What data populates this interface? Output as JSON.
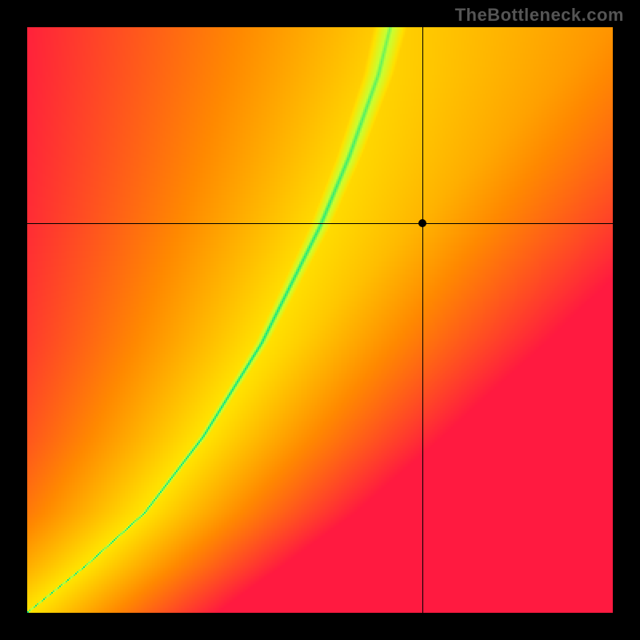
{
  "watermark": "TheBottleneck.com",
  "chart_data": {
    "type": "heatmap",
    "title": "",
    "xlabel": "",
    "ylabel": "",
    "xlim": [
      0,
      1
    ],
    "ylim": [
      0,
      1
    ],
    "marker": {
      "x": 0.675,
      "y": 0.665
    },
    "crosshair": {
      "x": 0.675,
      "y": 0.665
    },
    "ideal_curve": {
      "description": "Green band follows a superlinear ridge from (0,0) to roughly (0.62,1.0), widening upward.",
      "points": [
        {
          "x": 0.0,
          "y": 0.0
        },
        {
          "x": 0.1,
          "y": 0.08
        },
        {
          "x": 0.2,
          "y": 0.17
        },
        {
          "x": 0.3,
          "y": 0.3
        },
        {
          "x": 0.4,
          "y": 0.46
        },
        {
          "x": 0.5,
          "y": 0.66
        },
        {
          "x": 0.55,
          "y": 0.78
        },
        {
          "x": 0.6,
          "y": 0.92
        },
        {
          "x": 0.62,
          "y": 1.0
        }
      ]
    },
    "colorscale": {
      "low": "#ff1a40",
      "low_mid": "#ff8a00",
      "mid": "#ffe100",
      "high_mid": "#c8ff33",
      "high": "#00e589"
    }
  }
}
